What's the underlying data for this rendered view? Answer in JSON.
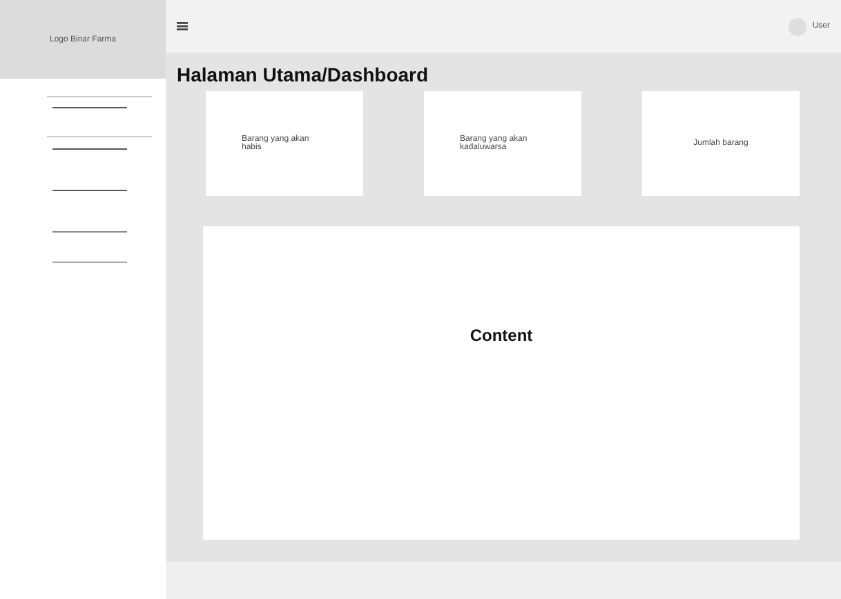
{
  "sidebar": {
    "logo": "Logo Binar Farma"
  },
  "topbar": {
    "user": "User"
  },
  "page_title": "Halaman Utama/Dashboard",
  "cards": [
    {
      "label": "Barang yang akan habis"
    },
    {
      "label": "Barang yang akan kadaluwarsa"
    },
    {
      "label": "Jumlah barang"
    }
  ],
  "content": {
    "label": "Content"
  }
}
